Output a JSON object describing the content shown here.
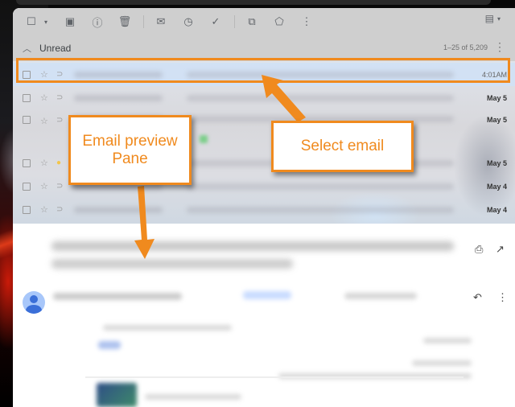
{
  "toolbar": {
    "icons": [
      "select-checkbox",
      "select-dropdown",
      "archive",
      "report-spam",
      "delete",
      "mark-unread",
      "snooze",
      "add-to-tasks",
      "move-to",
      "labels",
      "more"
    ],
    "density_icon": "view-density"
  },
  "section": {
    "title": "Unread",
    "pagination": "1–25 of 5,209"
  },
  "emails": [
    {
      "date": "4:01AM",
      "selected": true,
      "important_marker": "default",
      "unread": false
    },
    {
      "date": "May 5",
      "selected": false,
      "important_marker": "default",
      "unread": true
    },
    {
      "date": "May 5",
      "selected": false,
      "important_marker": "default",
      "unread": true
    },
    {
      "date": "May 5",
      "selected": false,
      "important_marker": "yellow",
      "unread": true
    },
    {
      "date": "May 4",
      "selected": false,
      "important_marker": "default",
      "unread": true
    },
    {
      "date": "May 4",
      "selected": false,
      "important_marker": "default",
      "unread": true
    }
  ],
  "preview": {
    "actions": [
      "print",
      "open-in-new-window"
    ],
    "message_actions": [
      "reply",
      "more"
    ]
  },
  "annotations": {
    "preview_callout_line1": "Email preview",
    "preview_callout_line2": "Pane",
    "select_callout": "Select email",
    "accent_color": "#f08a1e"
  }
}
